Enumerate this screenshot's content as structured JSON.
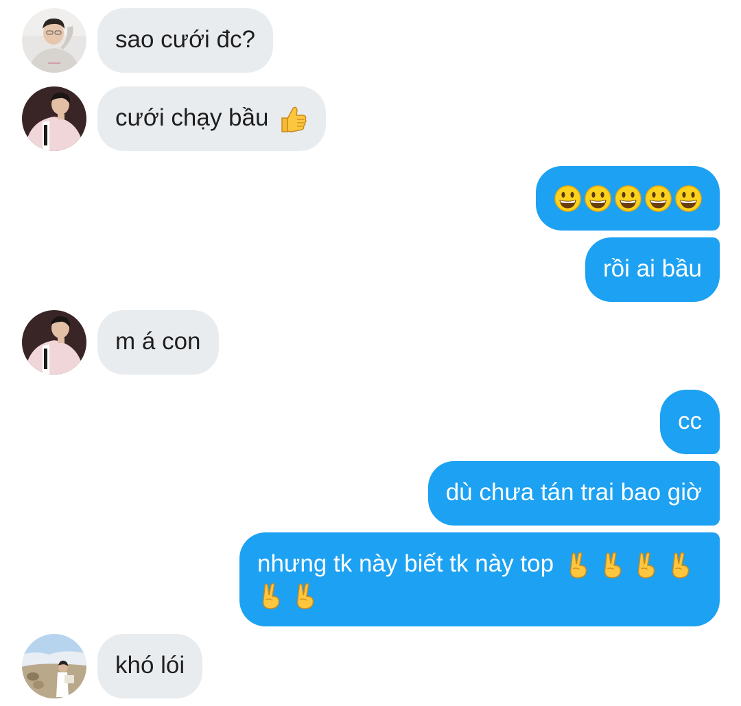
{
  "messages": [
    {
      "id": "m1",
      "side": "in",
      "text": "sao cưới đc?",
      "avatar": "avatar-white-hoodie"
    },
    {
      "id": "m2",
      "side": "in",
      "text": "cưới chạy bầu",
      "emoji": "thumbs-up-icon",
      "avatar": "avatar-pink-jacket"
    },
    {
      "id": "m3",
      "side": "out",
      "emoji_count": 5,
      "emoji": "grinning-face-icon"
    },
    {
      "id": "m4",
      "side": "out",
      "text": "rồi ai bầu"
    },
    {
      "id": "m5",
      "side": "in",
      "text": "m á con",
      "avatar": "avatar-pink-jacket"
    },
    {
      "id": "m6",
      "side": "out",
      "text": "cc"
    },
    {
      "id": "m7",
      "side": "out",
      "text": "dù chưa tán trai bao giờ"
    },
    {
      "id": "m8",
      "side": "out",
      "text": "nhưng tk này biết tk này top",
      "emoji_count": 6,
      "emoji": "victory-hand-icon"
    },
    {
      "id": "m9",
      "side": "in",
      "text": "khó lói",
      "avatar": "avatar-field-photo"
    }
  ],
  "colors": {
    "incoming_bubble": "#e9ecef",
    "outgoing_bubble": "#1da1f2",
    "outgoing_text": "#ffffff",
    "incoming_text": "#1f1f1f"
  }
}
